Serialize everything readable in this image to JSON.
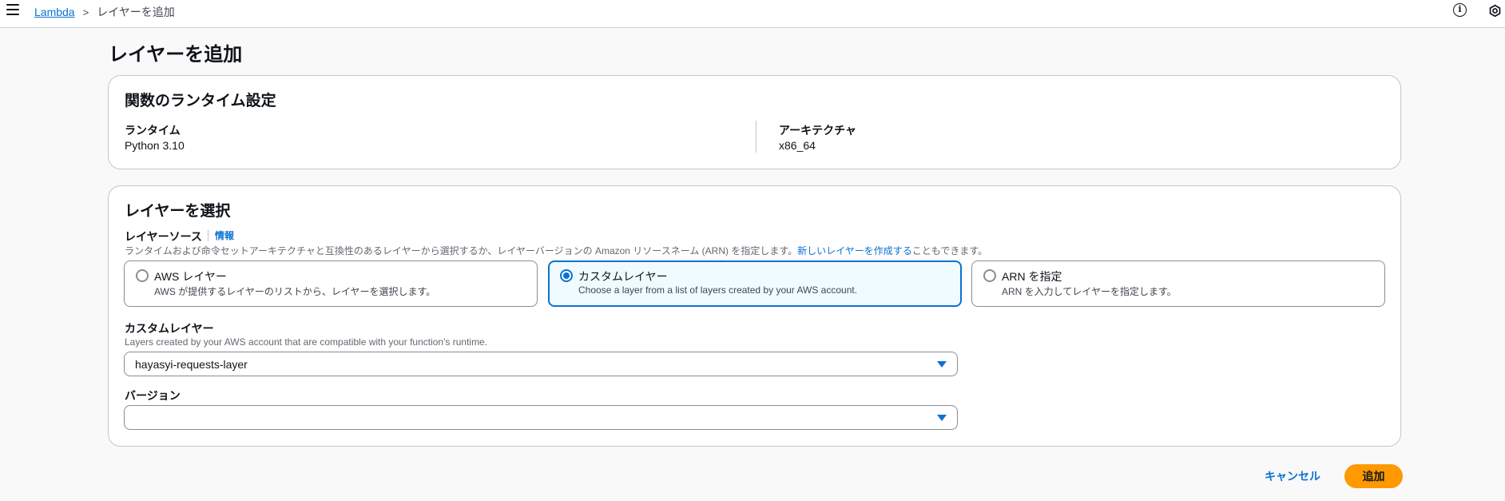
{
  "header": {
    "breadcrumbs": [
      {
        "label": "Lambda"
      },
      {
        "label": "レイヤーを追加"
      }
    ],
    "breadcrumb_separator": ">",
    "info_glyph": "i"
  },
  "page": {
    "title": "レイヤーを追加"
  },
  "runtime_settings": {
    "title": "関数のランタイム設定",
    "runtime_label": "ランタイム",
    "runtime_value": "Python 3.10",
    "architecture_label": "アーキテクチャ",
    "architecture_value": "x86_64"
  },
  "choose_layer": {
    "title": "レイヤーを選択",
    "source_label": "レイヤーソース",
    "info_link": "情報",
    "source_description": "ランタイムおよび命令セットアーキテクチャと互換性のあるレイヤーから選択するか、レイヤーバージョンの Amazon リソースネーム (ARN) を指定します。",
    "source_description_link": "新しいレイヤーを作成する",
    "source_description_suffix": "こともできます。",
    "tiles": [
      {
        "title": "AWS レイヤー",
        "description": "AWS が提供するレイヤーのリストから、レイヤーを選択します。",
        "selected": false
      },
      {
        "title": "カスタムレイヤー",
        "description": "Choose a layer from a list of layers created by your AWS account.",
        "selected": true
      },
      {
        "title": "ARN を指定",
        "description": "ARN を入力してレイヤーを指定します。",
        "selected": false
      }
    ],
    "custom_layer_label": "カスタムレイヤー",
    "custom_layer_description": "Layers created by your AWS account that are compatible with your function's runtime.",
    "custom_layer_value": "hayasyi-requests-layer",
    "version_label": "バージョン",
    "version_value": ""
  },
  "actions": {
    "cancel_label": "キャンセル",
    "add_label": "追加"
  },
  "colors": {
    "link": "#0972d3",
    "primary_button": "#ff9900",
    "selected_tile_bg": "#f0fbff"
  }
}
